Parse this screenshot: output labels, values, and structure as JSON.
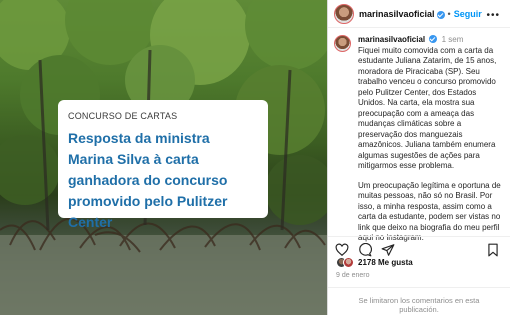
{
  "image_card": {
    "kicker": "CONCURSO DE CARTAS",
    "headline": "Resposta da ministra Marina Silva à carta ganhadora do concurso promovido pelo Pulitzer Center"
  },
  "header": {
    "username": "marinasilvaoficial",
    "separator": "•",
    "follow_label": "Seguir",
    "more_label": "•••"
  },
  "caption": {
    "username": "marinasilvaoficial",
    "time": "1 sem",
    "paragraph1": "Fiquei muito comovida com a carta da estudante Juliana Zatarim, de 15 anos, moradora de Piracicaba (SP). Seu trabalho venceu o concurso promovido pelo Pulitzer Center, dos Estados Unidos. Na carta, ela mostra sua preocupação com a ameaça das mudanças climáticas sobre a preservação dos manguezais amazônicos. Juliana também enumera algumas sugestões de ações para mitigarmos esse problema.",
    "paragraph2": "Um preocupação legítima e oportuna de muitas pessoas, não só no Brasil. Por isso, a minha resposta, assim como a carta da estudante, podem ser vistas no link que deixo na biografia do meu perfil aqui no instagram."
  },
  "actions": {
    "icons": [
      "heart-icon",
      "comment-icon",
      "share-icon",
      "bookmark-icon"
    ]
  },
  "likes": {
    "text": "2178 Me gusta"
  },
  "date": {
    "text": "9 de enero"
  },
  "comments_notice": {
    "text": "Se limitaron los comentarios en esta publicación."
  },
  "colors": {
    "follow": "#0095f6",
    "headline": "#1f6fa8",
    "verified": "#3897f0"
  }
}
